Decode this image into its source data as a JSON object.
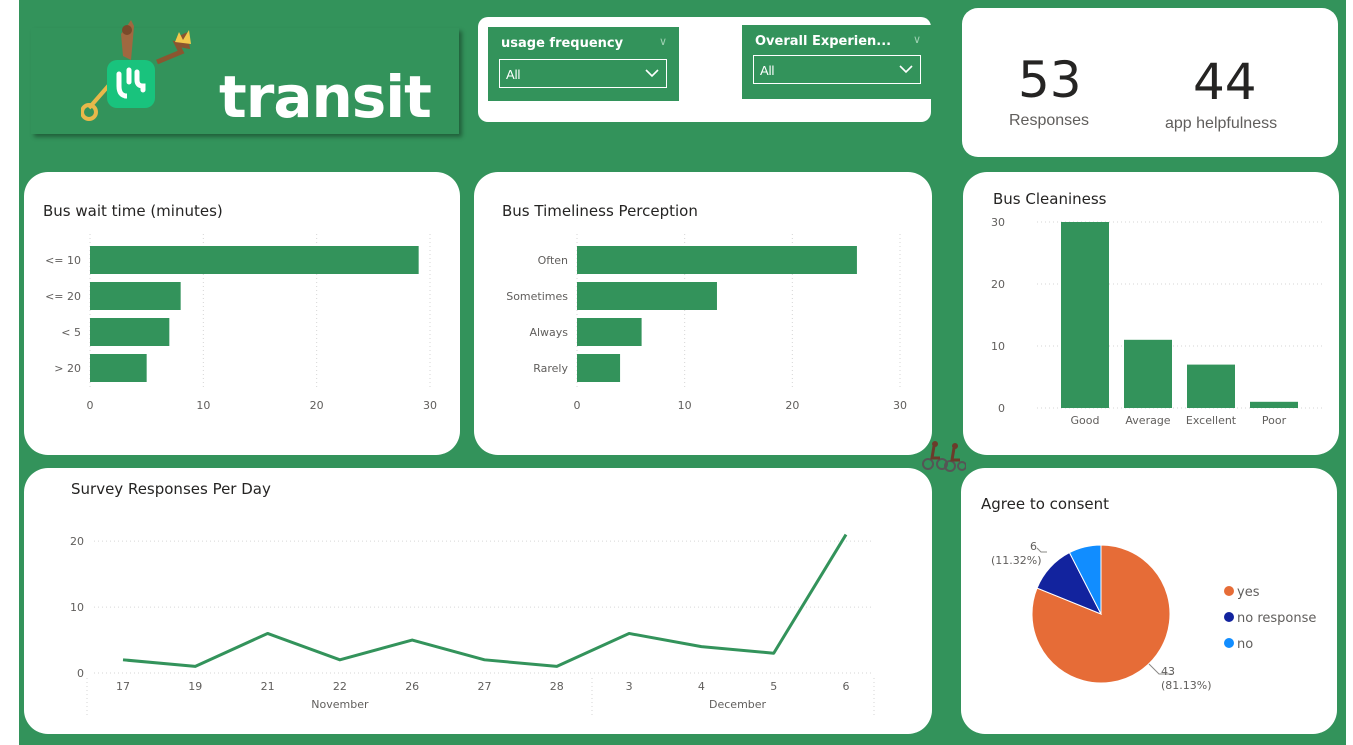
{
  "brand": {
    "name": "transit",
    "accent": "#33935b",
    "app_icon": "transit-app-icon",
    "mascot": "hands-holding-keys-and-crown"
  },
  "filters": [
    {
      "label": "usage frequency",
      "value": "All"
    },
    {
      "label": "Overall Experien...",
      "value": "All"
    }
  ],
  "kpis": [
    {
      "value": "53",
      "label": "Responses"
    },
    {
      "value": "44",
      "label": "app helpfulness"
    }
  ],
  "decoration": {
    "cyclists_icon": "cyclists-icon"
  },
  "charts": {
    "wait_time": {
      "title": "Bus wait time (minutes)",
      "chart_data": {
        "type": "bar",
        "orientation": "horizontal",
        "categories": [
          "<= 10",
          "<= 20",
          "< 5",
          "> 20"
        ],
        "values": [
          29,
          8,
          7,
          5
        ],
        "xlim": [
          0,
          30
        ],
        "ticks": [
          "0",
          "10",
          "20",
          "30"
        ],
        "grid": true,
        "color": "#33935b"
      }
    },
    "timeliness": {
      "title": "Bus Timeliness Perception",
      "chart_data": {
        "type": "bar",
        "orientation": "horizontal",
        "categories": [
          "Often",
          "Sometimes",
          "Always",
          "Rarely"
        ],
        "values": [
          26,
          13,
          6,
          4
        ],
        "xlim": [
          0,
          30
        ],
        "ticks": [
          "0",
          "10",
          "20",
          "30"
        ],
        "grid": true,
        "color": "#33935b"
      }
    },
    "cleanliness": {
      "title": "Bus Cleaniness",
      "chart_data": {
        "type": "bar",
        "orientation": "vertical",
        "categories": [
          "Good",
          "Average",
          "Excellent",
          "Poor"
        ],
        "values": [
          30,
          11,
          7,
          1
        ],
        "ylim": [
          0,
          30
        ],
        "ticks": [
          "0",
          "10",
          "20",
          "30"
        ],
        "grid": true,
        "color": "#33935b"
      }
    },
    "per_day": {
      "title": "Survey Responses Per Day",
      "chart_data": {
        "type": "line",
        "x": [
          "17",
          "19",
          "21",
          "22",
          "26",
          "27",
          "28",
          "3",
          "4",
          "5",
          "6"
        ],
        "groups": [
          {
            "label": "November",
            "count": 7
          },
          {
            "label": "December",
            "count": 4
          }
        ],
        "series": [
          {
            "values": [
              2,
              1,
              6,
              2,
              5,
              2,
              1,
              6,
              4,
              3,
              21
            ]
          }
        ],
        "ylim": [
          0,
          22
        ],
        "ticks": [
          "0",
          "10",
          "20"
        ],
        "grid": true,
        "color": "#33935b"
      }
    },
    "consent": {
      "title": "Agree to consent",
      "chart_data": {
        "type": "pie",
        "slices": [
          {
            "label": "yes",
            "value": 43,
            "pct": "81.13%",
            "color": "#e66c37"
          },
          {
            "label": "no response",
            "value": 6,
            "pct": "11.32%",
            "color": "#12239e"
          },
          {
            "label": "no",
            "value": 4,
            "pct": "7.55%",
            "color": "#118dff"
          }
        ],
        "data_labels": [
          {
            "value": "43",
            "pct": "(81.13%)"
          },
          {
            "value": "6",
            "pct": "(11.32%)"
          }
        ],
        "legend": "right"
      }
    }
  }
}
